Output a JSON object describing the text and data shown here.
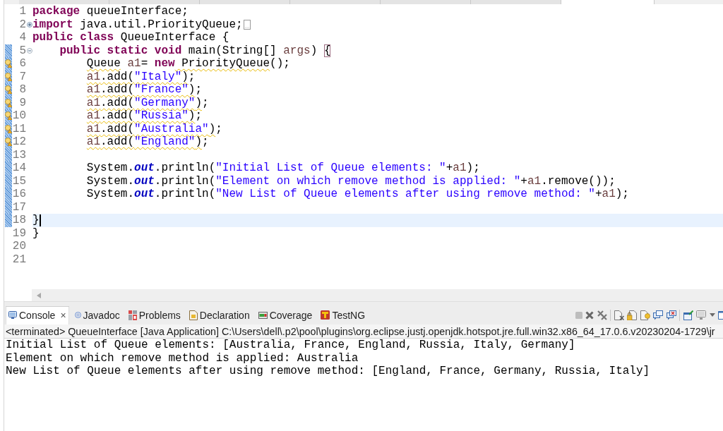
{
  "editor_tabs": [
    {
      "selected": false
    },
    {
      "selected": false
    },
    {
      "selected": false
    },
    {
      "selected": false
    },
    {
      "selected": false
    },
    {
      "selected": false
    },
    {
      "selected": true
    }
  ],
  "code_lines": [
    {
      "number": "1",
      "warning": false,
      "in_range": false,
      "current": false,
      "tokens": [
        {
          "kind": "keyword",
          "text": "package",
          "warn": false
        },
        {
          "kind": "plain",
          "text": " queueInterface;",
          "warn": false
        }
      ]
    },
    {
      "number": "2",
      "warning": false,
      "in_range": false,
      "current": false,
      "fold": {
        "collapsed": true
      },
      "tokens": [
        {
          "kind": "keyword",
          "text": "import",
          "warn": false
        },
        {
          "kind": "plain",
          "text": " java.util.PriorityQueue;",
          "warn": false
        }
      ]
    },
    {
      "number": "4",
      "warning": false,
      "in_range": false,
      "current": false,
      "tokens": [
        {
          "kind": "keyword",
          "text": "public class",
          "warn": false
        },
        {
          "kind": "plain",
          "text": " QueueInterface {",
          "warn": false
        }
      ]
    },
    {
      "number": "5",
      "warning": false,
      "in_range": true,
      "current": false,
      "fold": {
        "collapsed": false
      },
      "tokens": [
        {
          "kind": "keyword",
          "text": "    public static void",
          "warn": false
        },
        {
          "kind": "plain",
          "text": " main(String[] ",
          "warn": false
        },
        {
          "kind": "variable",
          "text": "args",
          "warn": false
        },
        {
          "kind": "plain",
          "text": ") ",
          "warn": false
        },
        {
          "kind": "bracket",
          "text": "{",
          "warn": false
        }
      ]
    },
    {
      "number": "6",
      "warning": true,
      "in_range": true,
      "current": false,
      "tokens": [
        {
          "kind": "plain",
          "text": "        Queue",
          "warn": true
        },
        {
          "kind": "variable",
          "text": " a1",
          "warn": false
        },
        {
          "kind": "plain",
          "text": "= ",
          "warn": false
        },
        {
          "kind": "keyword",
          "text": "new",
          "warn": false
        },
        {
          "kind": "plain",
          "text": " PriorityQueue",
          "warn": true
        },
        {
          "kind": "plain",
          "text": "();",
          "warn": false
        }
      ]
    },
    {
      "number": "7",
      "warning": true,
      "in_range": true,
      "current": false,
      "tokens": [
        {
          "kind": "variable",
          "text": "        a1",
          "warn": true
        },
        {
          "kind": "plain",
          "text": ".add(",
          "warn": true
        },
        {
          "kind": "string",
          "text": "\"Italy\"",
          "warn": true
        },
        {
          "kind": "plain",
          "text": ")",
          "warn": true
        },
        {
          "kind": "plain",
          "text": ";",
          "warn": false
        }
      ]
    },
    {
      "number": "8",
      "warning": true,
      "in_range": true,
      "current": false,
      "tokens": [
        {
          "kind": "variable",
          "text": "        a1",
          "warn": true
        },
        {
          "kind": "plain",
          "text": ".add(",
          "warn": true
        },
        {
          "kind": "string",
          "text": "\"France\"",
          "warn": true
        },
        {
          "kind": "plain",
          "text": ")",
          "warn": true
        },
        {
          "kind": "plain",
          "text": ";",
          "warn": false
        }
      ]
    },
    {
      "number": "9",
      "warning": true,
      "in_range": true,
      "current": false,
      "tokens": [
        {
          "kind": "variable",
          "text": "        a1",
          "warn": true
        },
        {
          "kind": "plain",
          "text": ".add(",
          "warn": true
        },
        {
          "kind": "string",
          "text": "\"Germany\"",
          "warn": true
        },
        {
          "kind": "plain",
          "text": ")",
          "warn": true
        },
        {
          "kind": "plain",
          "text": ";",
          "warn": false
        }
      ]
    },
    {
      "number": "10",
      "warning": true,
      "in_range": true,
      "current": false,
      "tokens": [
        {
          "kind": "variable",
          "text": "        a1",
          "warn": true
        },
        {
          "kind": "plain",
          "text": ".add(",
          "warn": true
        },
        {
          "kind": "string",
          "text": "\"Russia\"",
          "warn": true
        },
        {
          "kind": "plain",
          "text": ")",
          "warn": true
        },
        {
          "kind": "plain",
          "text": ";",
          "warn": false
        }
      ]
    },
    {
      "number": "11",
      "warning": true,
      "in_range": true,
      "current": false,
      "tokens": [
        {
          "kind": "variable",
          "text": "        a1",
          "warn": true
        },
        {
          "kind": "plain",
          "text": ".add(",
          "warn": true
        },
        {
          "kind": "string",
          "text": "\"Australia\"",
          "warn": true
        },
        {
          "kind": "plain",
          "text": ")",
          "warn": true
        },
        {
          "kind": "plain",
          "text": ";",
          "warn": false
        }
      ]
    },
    {
      "number": "12",
      "warning": true,
      "in_range": true,
      "current": false,
      "tokens": [
        {
          "kind": "variable",
          "text": "        a1",
          "warn": true
        },
        {
          "kind": "plain",
          "text": ".add(",
          "warn": true
        },
        {
          "kind": "string",
          "text": "\"England\"",
          "warn": true
        },
        {
          "kind": "plain",
          "text": ")",
          "warn": true
        },
        {
          "kind": "plain",
          "text": ";",
          "warn": false
        }
      ]
    },
    {
      "number": "13",
      "warning": false,
      "in_range": true,
      "current": false
    },
    {
      "number": "14",
      "warning": false,
      "in_range": true,
      "current": false,
      "tokens": [
        {
          "kind": "plain",
          "text": "        System.",
          "warn": false
        },
        {
          "kind": "field",
          "text": "out",
          "warn": false
        },
        {
          "kind": "plain",
          "text": ".println(",
          "warn": false
        },
        {
          "kind": "string",
          "text": "\"Initial List of Queue elements: \"",
          "warn": false
        },
        {
          "kind": "plain",
          "text": "+",
          "warn": false
        },
        {
          "kind": "variable",
          "text": "a1",
          "warn": false
        },
        {
          "kind": "plain",
          "text": ");",
          "warn": false
        }
      ]
    },
    {
      "number": "15",
      "warning": false,
      "in_range": true,
      "current": false,
      "tokens": [
        {
          "kind": "plain",
          "text": "        System.",
          "warn": false
        },
        {
          "kind": "field",
          "text": "out",
          "warn": false
        },
        {
          "kind": "plain",
          "text": ".println(",
          "warn": false
        },
        {
          "kind": "string",
          "text": "\"Element on which remove method is applied: \"",
          "warn": false
        },
        {
          "kind": "plain",
          "text": "+",
          "warn": false
        },
        {
          "kind": "variable",
          "text": "a1",
          "warn": false
        },
        {
          "kind": "plain",
          "text": ".remove());",
          "warn": false
        }
      ]
    },
    {
      "number": "16",
      "warning": false,
      "in_range": true,
      "current": false,
      "tokens": [
        {
          "kind": "plain",
          "text": "        System.",
          "warn": false
        },
        {
          "kind": "field",
          "text": "out",
          "warn": false
        },
        {
          "kind": "plain",
          "text": ".println(",
          "warn": false
        },
        {
          "kind": "string",
          "text": "\"New List of Queue elements after using remove method: \"",
          "warn": false
        },
        {
          "kind": "plain",
          "text": "+",
          "warn": false
        },
        {
          "kind": "variable",
          "text": "a1",
          "warn": false
        },
        {
          "kind": "plain",
          "text": ");",
          "warn": false
        }
      ]
    },
    {
      "number": "17",
      "warning": false,
      "in_range": true,
      "current": false
    },
    {
      "number": "18",
      "warning": false,
      "in_range": true,
      "current": true,
      "tokens": [
        {
          "kind": "plain",
          "text": "}",
          "warn": false
        }
      ]
    },
    {
      "number": "19",
      "warning": false,
      "in_range": false,
      "current": false,
      "tokens": [
        {
          "kind": "plain",
          "text": "}",
          "warn": false
        }
      ]
    },
    {
      "number": "20",
      "warning": false,
      "in_range": false,
      "current": false
    },
    {
      "number": "21",
      "warning": false,
      "in_range": false,
      "current": false
    }
  ],
  "panel_tabs": [
    {
      "kind": "console",
      "label": "Console",
      "close": "×",
      "selected": true
    },
    {
      "kind": "javadoc",
      "label": "Javadoc",
      "selected": false
    },
    {
      "kind": "problems",
      "label": "Problems",
      "selected": false
    },
    {
      "kind": "declaration",
      "label": "Declaration",
      "selected": false
    },
    {
      "kind": "coverage",
      "label": "Coverage",
      "selected": false
    },
    {
      "kind": "testng",
      "label": "TestNG",
      "selected": false
    }
  ],
  "console": {
    "description": "<terminated> QueueInterface [Java Application] C:\\Users\\dell\\.p2\\pool\\plugins\\org.eclipse.justj.openjdk.hotspot.jre.full.win32.x86_64_17.0.6.v20230204-1729\\jr",
    "output": [
      "Initial List of Queue elements: [Australia, France, England, Russia, Italy, Germany]",
      "Element on which remove method is applied: Australia",
      "New List of Queue elements after using remove method: [England, France, Germany, Russia, Italy]"
    ]
  }
}
